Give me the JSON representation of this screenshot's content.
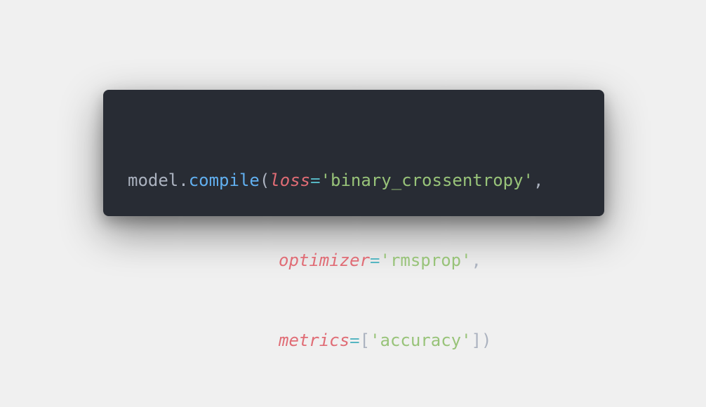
{
  "theme": {
    "page_background": "#f0f0f0",
    "card_background": "#282c34",
    "plain_color": "#abb2bf",
    "function_color": "#61afef",
    "parameter_color": "#e06c75",
    "operator_color": "#56b6c2",
    "string_color": "#98c379"
  },
  "code": {
    "line1": {
      "object": "model",
      "dot": ".",
      "method": "compile",
      "open_paren": "(",
      "param": "loss",
      "equals": "=",
      "value": "'binary_crossentropy'",
      "comma": ","
    },
    "line2": {
      "param": "optimizer",
      "equals": "=",
      "value": "'rmsprop'",
      "comma": ","
    },
    "line3": {
      "param": "metrics",
      "equals": "=",
      "open_bracket": "[",
      "value": "'accuracy'",
      "close": "])"
    }
  }
}
